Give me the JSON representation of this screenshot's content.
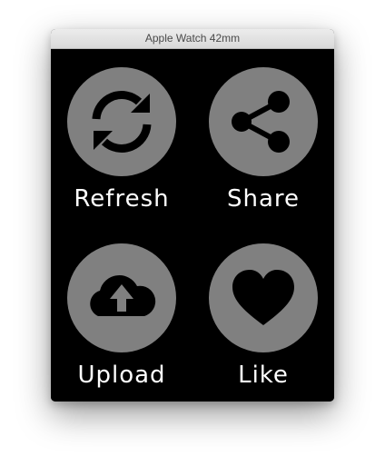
{
  "window": {
    "title": "Apple Watch 42mm"
  },
  "colors": {
    "screen_background": "#000000",
    "button_circle": "#808080",
    "icon_fill": "#000000",
    "label_text": "#ffffff"
  },
  "buttons": [
    {
      "label": "Refresh",
      "icon": "refresh-icon"
    },
    {
      "label": "Share",
      "icon": "share-icon"
    },
    {
      "label": "Upload",
      "icon": "cloud-upload-icon"
    },
    {
      "label": "Like",
      "icon": "heart-icon"
    }
  ]
}
